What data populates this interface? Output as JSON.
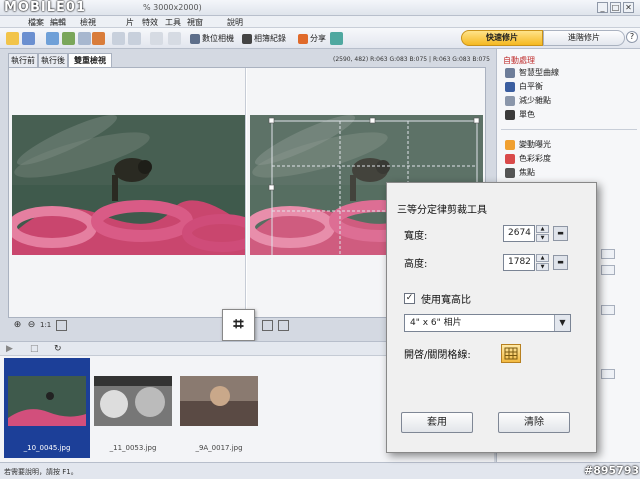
{
  "titlebar": {
    "watermark": "MOBILE01",
    "title_fragment": "% 3000x2000)",
    "controls": [
      "_",
      "□",
      "✕"
    ]
  },
  "menubar": {
    "items": [
      "檔案",
      "編輯",
      "檢視",
      "片",
      "特效",
      "工具",
      "視窗",
      "說明"
    ]
  },
  "toolbar": {
    "buttons": [
      "數位相機",
      "相簿紀錄",
      "分享"
    ],
    "mode_tabs": [
      "快速修片",
      "進階修片"
    ],
    "help": "?"
  },
  "viewer": {
    "tabs": [
      "執行前",
      "執行後",
      "雙重檢視"
    ],
    "active_tab": 2,
    "coords": "(2590, 482) R:063 G:083 B:075 | R:063 G:083 B:075"
  },
  "crop_tool": {
    "icon": "crop-icon",
    "glyph": "⌗"
  },
  "right_panel": {
    "section1_title": "自動處理",
    "section1_items": [
      "智慧型曲線",
      "白平衡",
      "減少雜點",
      "單色"
    ],
    "section2_items": [
      "變動曝光",
      "色彩彩度",
      "焦點"
    ]
  },
  "filmstrip": {
    "thumbs": [
      {
        "label": "_10_0045.jpg",
        "selected": true
      },
      {
        "label": "_11_0053.jpg",
        "selected": false
      },
      {
        "label": "_9A_0017.jpg",
        "selected": false
      }
    ]
  },
  "status": {
    "text": "若需要說明，請按 F1。",
    "id_watermark": "#895793"
  },
  "dialog": {
    "title": "三等分定律剪裁工具",
    "width_label": "寬度:",
    "width_value": "2674",
    "height_label": "高度:",
    "height_value": "1782",
    "aspect_checkbox_label": "使用寬高比",
    "aspect_checked": true,
    "aspect_select": "4\" x 6\" 相片",
    "grid_toggle_label": "開啓/關閉格線:",
    "apply_button": "套用",
    "clear_button": "清除"
  },
  "colors": {
    "accent_yellow": "#f5b820",
    "selected_blue": "#1c3f98",
    "panel_heading_red": "#c03030"
  }
}
